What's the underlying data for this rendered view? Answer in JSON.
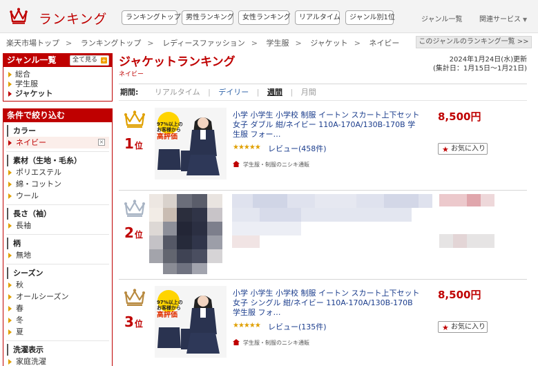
{
  "header": {
    "logo_text": "ランキング",
    "nav_buttons": [
      "ランキングトップ",
      "男性ランキング",
      "女性ランキング",
      "リアルタイム",
      "ジャンル別1位"
    ],
    "nav_links": [
      "ジャンル一覧",
      "関連サービス"
    ]
  },
  "breadcrumb": [
    "楽天市場トップ",
    "ランキングトップ",
    "レディースファッション",
    "学生服",
    "ジャケット",
    "ネイビー"
  ],
  "genre_ranking_link": "このジャンルのランキング一覧 >>",
  "genre_box": {
    "title": "ジャンル一覧",
    "see_all": "全て見る",
    "items": [
      "総合",
      "学生服",
      "ジャケット"
    ]
  },
  "filter_box": {
    "title": "条件で絞り込む",
    "sections": [
      {
        "title": "カラー",
        "items": [
          "ネイビー"
        ]
      },
      {
        "title": "素材（生地・毛糸）",
        "items": [
          "ポリエステル",
          "綿・コットン",
          "ウール"
        ]
      },
      {
        "title": "長さ（袖）",
        "items": [
          "長袖"
        ]
      },
      {
        "title": "柄",
        "items": [
          "無地"
        ]
      },
      {
        "title": "シーズン",
        "items": [
          "秋",
          "オールシーズン",
          "春",
          "冬",
          "夏"
        ]
      },
      {
        "title": "洗濯表示",
        "items": [
          "家庭洗濯"
        ]
      }
    ]
  },
  "main": {
    "title": "ジャケットランキング",
    "subtitle": "ネイビー",
    "update_date": "2024年1月24日(水)更新",
    "aggregation": "(集計日：1月15日〜1月21日)",
    "period": {
      "label": "期間:",
      "options": [
        "リアルタイム",
        "デイリー",
        "週間",
        "月間"
      ]
    }
  },
  "products": [
    {
      "rank": "1",
      "rank_suffix": "位",
      "title": "小学 小学生 小学校 制服 イートン スカート上下セット 女子 ダブル 紺/ネイビー 110A-170A/130B-170B 学生服 フォー…",
      "stars": "★★★★★",
      "review": "レビュー(458件)",
      "shop": "学生服・制服のニシキ通販",
      "price": "8,500円",
      "fav": "お気に入り",
      "thumb_badge_top": "97%以上の",
      "thumb_badge_mid": "お客様から",
      "thumb_badge_bottom": "高評価"
    },
    {
      "rank": "2",
      "rank_suffix": "位"
    },
    {
      "rank": "3",
      "rank_suffix": "位",
      "title": "小学 小学生 小学校 制服 イートン スカート上下セット 女子 シングル 紺/ネイビー 110A-170A/130B-170B 学生服 フォ…",
      "stars": "★★★★★",
      "review": "レビュー(135件)",
      "shop": "学生服・制服のニシキ通販",
      "price": "8,500円",
      "fav": "お気に入り",
      "thumb_badge_top": "97%以上の",
      "thumb_badge_mid": "お客様から",
      "thumb_badge_bottom": "高評価"
    }
  ],
  "colors": {
    "brand_red": "#bf0000",
    "link_blue": "#1a3c8c",
    "gold": "#e0a000",
    "silver": "#a8b4c4",
    "bronze": "#b88a40"
  }
}
